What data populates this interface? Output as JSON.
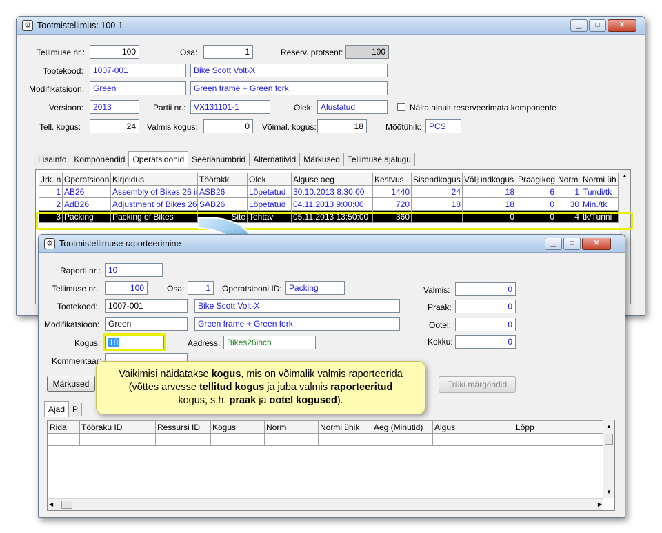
{
  "main": {
    "title": "Tootmistellimus: 100-1",
    "labels": {
      "order_nr": "Tellimuse nr.:",
      "part": "Osa:",
      "reserve_pct": "Reserv. protsent:",
      "product_code": "Tootekood:",
      "modification": "Modifikatsioon:",
      "version": "Versioon:",
      "batch_nr": "Partii nr.:",
      "state": "Olek:",
      "show_unreserved": "Näita ainult reserveerimata komponente",
      "ordered_qty": "Tell. kogus:",
      "done_qty": "Valmis kogus:",
      "possible_qty": "Võimal. kogus:",
      "unit": "Mõõtühik:"
    },
    "values": {
      "order_nr": "100",
      "part": "1",
      "reserve_pct": "100",
      "product_code": "1007-001",
      "product_name": "Bike Scott Volt-X",
      "modification": "Green",
      "modification_desc": "Green frame + Green fork",
      "version": "2013",
      "batch_nr": "VX131101-1",
      "state": "Alustatud",
      "ordered_qty": "24",
      "done_qty": "0",
      "possible_qty": "18",
      "unit": "PCS"
    },
    "tabs": [
      "Lisainfo",
      "Komponendid",
      "Operatsioonid",
      "Seerianumbrid",
      "Alternatiivid",
      "Märkused",
      "Tellimuse ajalugu"
    ],
    "active_tab": "Operatsioonid",
    "columns": [
      "Jrk. n",
      "Operatsiooni",
      "Kirjeldus",
      "Töörakk",
      "Olek",
      "Alguse aeg",
      "Kestvus",
      "Sisendkogus",
      "Väljundkogus",
      "Praagikog",
      "Norm",
      "Normi üh"
    ],
    "rows": [
      [
        "1",
        "AB26",
        "Assembly of Bikes 26 in",
        "ASB26",
        "Lõpetatud",
        "30.10.2013 8:30:00",
        "1440",
        "24",
        "18",
        "6",
        "1",
        "Tundi/tk"
      ],
      [
        "2",
        "AdB26",
        "Adjustment of Bikes 26",
        "SAB26",
        "Lõpetatud",
        "04.11.2013 9:00:00",
        "720",
        "18",
        "18",
        "0",
        "30",
        "Min./tk"
      ],
      [
        "3",
        "Packing",
        "Packing of Bikes",
        "Site",
        "Tehtav",
        "05.11.2013 13:50:00",
        "360",
        "",
        "0",
        "0",
        "4",
        "tk/Tunni"
      ]
    ]
  },
  "dialog": {
    "title": "Tootmistellimuse raporteerimine",
    "labels": {
      "report_nr": "Raporti nr.:",
      "order_nr": "Tellimuse nr.:",
      "part": "Osa:",
      "operation_id": "Operatsiooni ID:",
      "product_code": "Tootekood:",
      "modification": "Modifikatsioon:",
      "quantity": "Kogus:",
      "address": "Aadress:",
      "comment": "Kommentaar:",
      "done": "Valmis:",
      "scrap": "Praak:",
      "waiting": "Ootel:",
      "total": "Kokku:"
    },
    "values": {
      "report_nr": "10",
      "order_nr": "100",
      "part": "1",
      "operation_id": "Packing",
      "product_code": "1007-001",
      "product_name": "Bike Scott Volt-X",
      "modification": "Green",
      "modification_desc": "Green frame + Green fork",
      "quantity": "18",
      "address": "Bikes26inch",
      "done": "0",
      "scrap": "0",
      "waiting": "0",
      "total": "0"
    },
    "buttons": {
      "notes": "Märkused",
      "print_labels": "Trüki märgendid"
    },
    "tabs": [
      "Ajad",
      "P"
    ],
    "active_tab": "Ajad",
    "columns": [
      "Rida",
      "Tööraku ID",
      "Ressursi ID",
      "Kogus",
      "Norm",
      "Normi ühik",
      "Aeg (Minutid)",
      "Algus",
      "Lõpp"
    ]
  },
  "callout": {
    "l1a": "Vaikimisi näidatakse ",
    "l1b": "kogus",
    "l1c": ", mis on võimalik valmis raporteerida",
    "l2a": "(võttes arvesse ",
    "l2b": "tellitud kogus",
    "l2c": " ja juba valmis ",
    "l2d": "raporteeritud",
    "l3a": "kogus, s.h. ",
    "l3b": "praak",
    "l3c": "  ja ",
    "l3d": "ootel kogused",
    "l3e": ")."
  },
  "colors": {
    "highlight": "#e8f000",
    "callout_bg": "#fdfcb2",
    "arrow": "#2f8fd6",
    "link_text": "#1a1ae0"
  }
}
